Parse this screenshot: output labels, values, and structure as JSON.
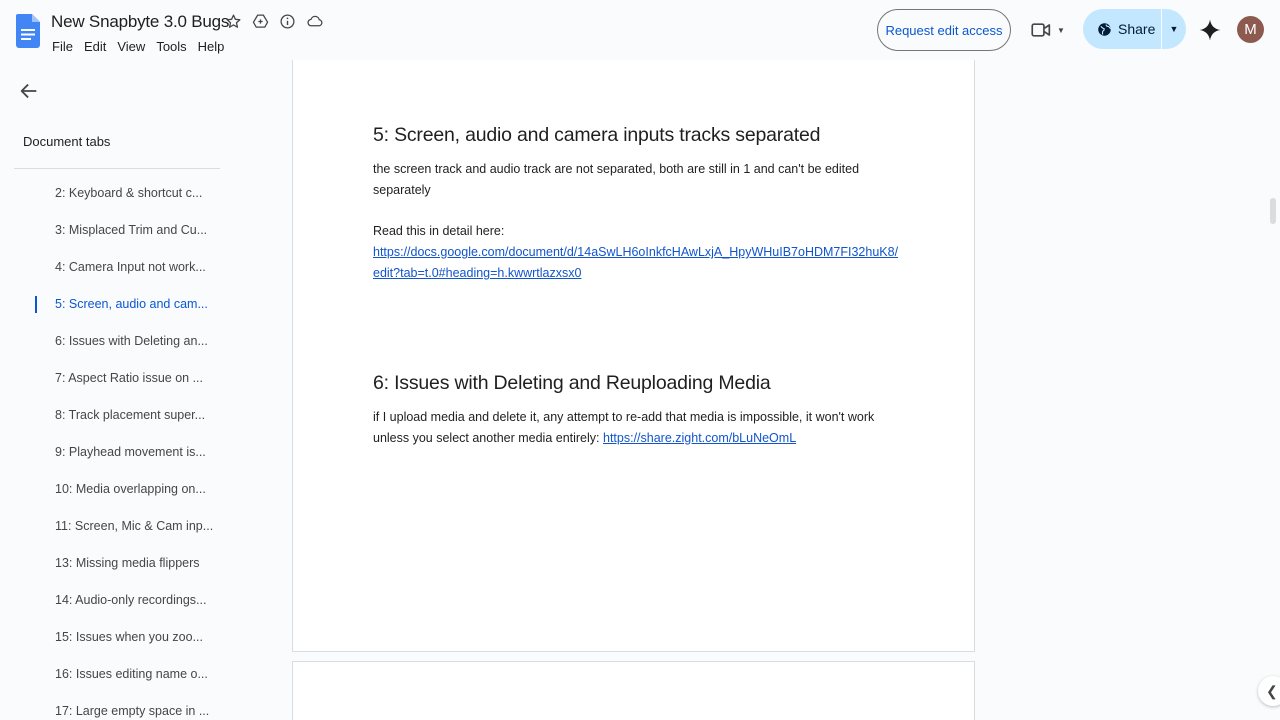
{
  "header": {
    "title": "New Snapbyte 3.0 Bugs",
    "menu": [
      "File",
      "Edit",
      "View",
      "Tools",
      "Help"
    ],
    "request_edit_label": "Request edit access",
    "share_label": "Share",
    "avatar_initial": "M"
  },
  "sidebar": {
    "heading": "Document tabs",
    "tabs": [
      {
        "label": "2: Keyboard & shortcut c..."
      },
      {
        "label": "3: Misplaced Trim and Cu..."
      },
      {
        "label": "4: Camera Input not work..."
      },
      {
        "label": "5: Screen, audio and cam..."
      },
      {
        "label": "6: Issues with Deleting an..."
      },
      {
        "label": "7: Aspect Ratio issue on ..."
      },
      {
        "label": "8: Track placement super..."
      },
      {
        "label": "9: Playhead movement is..."
      },
      {
        "label": "10: Media overlapping on..."
      },
      {
        "label": "11: Screen, Mic & Cam inp..."
      },
      {
        "label": "13: Missing media flippers"
      },
      {
        "label": "14: Audio-only recordings..."
      },
      {
        "label": "15: Issues when you zoo..."
      },
      {
        "label": "16: Issues editing name o..."
      },
      {
        "label": "17: Large empty space in ..."
      }
    ],
    "active_index": 3
  },
  "document": {
    "section5": {
      "heading": "5: Screen, audio and camera inputs tracks separated",
      "body": "the screen track and audio track are not separated, both are still in 1 and can't be edited separately",
      "detail_label": "Read this in detail here:",
      "link": "https://docs.google.com/document/d/14aSwLH6oInkfcHAwLxjA_HpyWHuIB7oHDM7FI32huK8/edit?tab=t.0#heading=h.kwwrtlazxsx0"
    },
    "section6": {
      "heading": "6: Issues with Deleting and Reuploading Media",
      "body": "if I upload media and delete it, any attempt to re-add that media is impossible, it won't work unless you select another media entirely:",
      "link": "https://share.zight.com/bLuNeOmL"
    }
  },
  "colors": {
    "accent": "#0b57d0",
    "link": "#1155cc",
    "share_bg": "#c2e7ff",
    "background": "#f9fbfd"
  }
}
